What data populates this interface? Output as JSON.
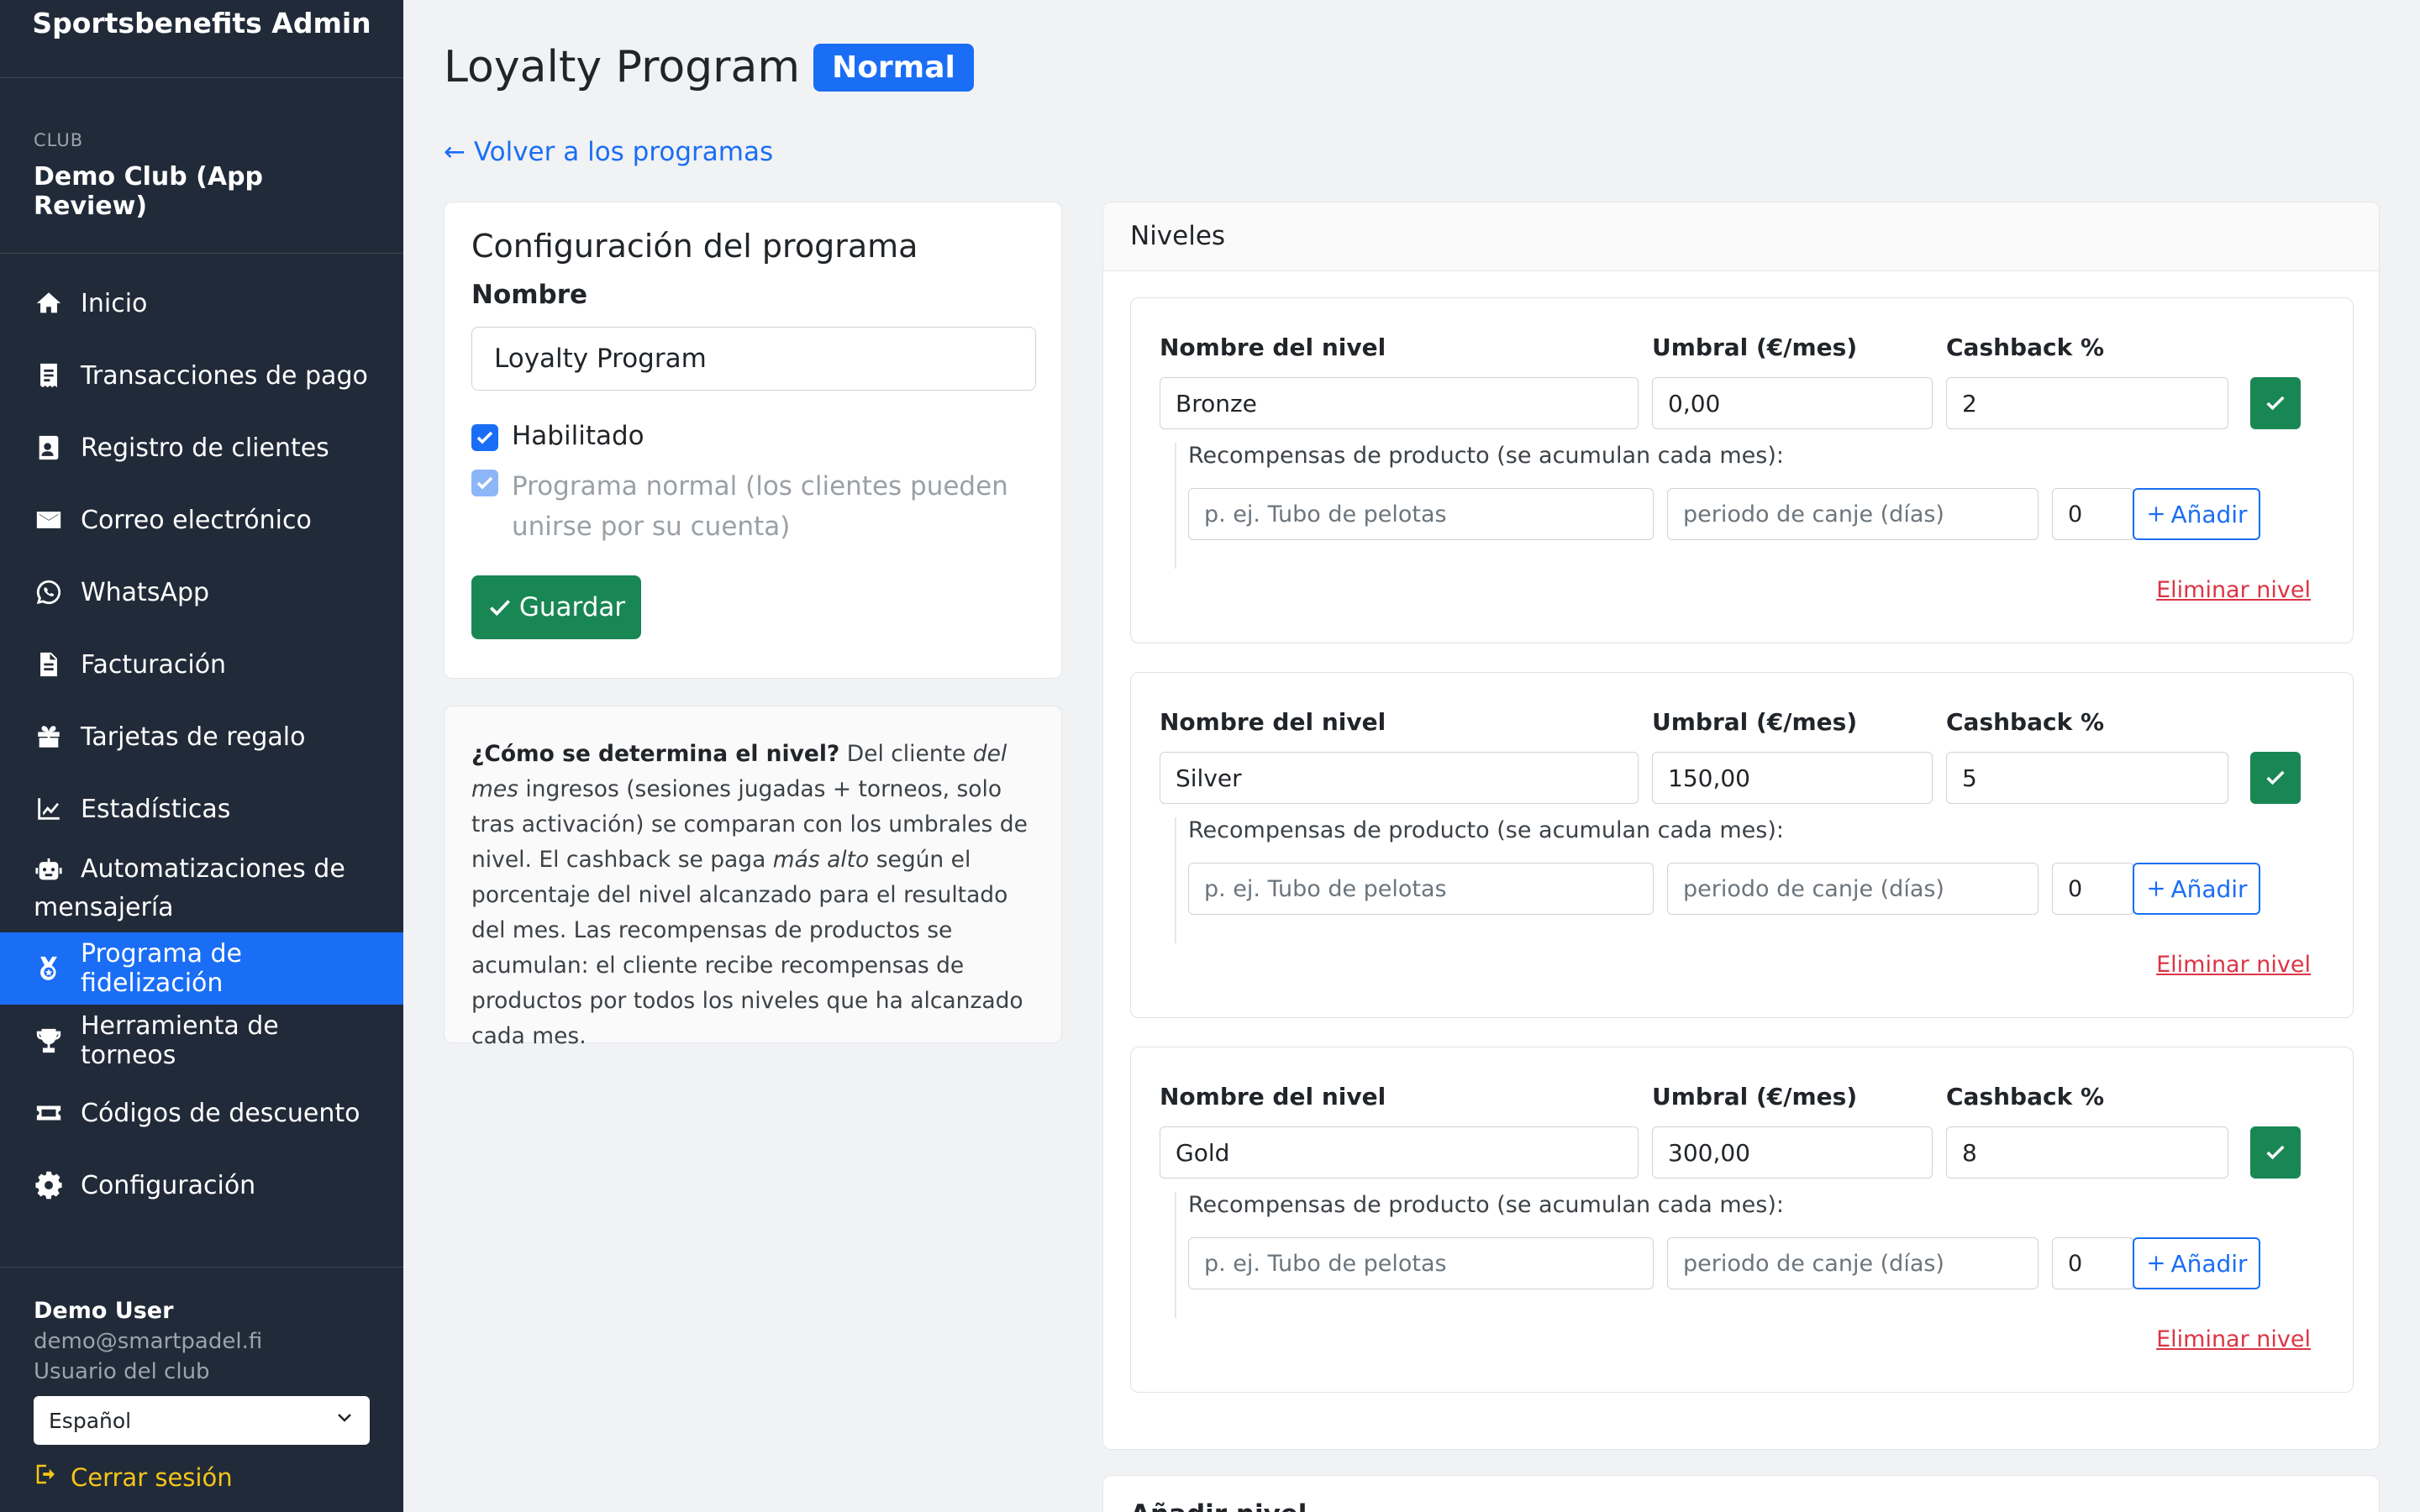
{
  "brand": "Sportsbenefits Admin",
  "club": {
    "caption": "CLUB",
    "name": "Demo Club (App Review)"
  },
  "nav": [
    {
      "label": "Inicio",
      "icon": "home-icon"
    },
    {
      "label": "Transacciones de pago",
      "icon": "receipt-icon"
    },
    {
      "label": "Registro de clientes",
      "icon": "contact-card-icon"
    },
    {
      "label": "Correo electrónico",
      "icon": "envelope-icon"
    },
    {
      "label": "WhatsApp",
      "icon": "whatsapp-icon"
    },
    {
      "label": "Facturación",
      "icon": "document-icon"
    },
    {
      "label": "Tarjetas de regalo",
      "icon": "gift-icon"
    },
    {
      "label": "Estadísticas",
      "icon": "chart-line-icon"
    },
    {
      "label": "Automatizaciones de mensajería",
      "icon": "robot-icon"
    },
    {
      "label": "Programa de fidelización",
      "icon": "medal-icon",
      "active": true
    },
    {
      "label": "Herramienta de torneos",
      "icon": "trophy-icon"
    },
    {
      "label": "Códigos de descuento",
      "icon": "ticket-icon"
    },
    {
      "label": "Configuración",
      "icon": "gear-icon"
    }
  ],
  "user": {
    "name": "Demo User",
    "email": "demo@smartpadel.fi",
    "role": "Usuario del club",
    "language": "Español",
    "logout": "Cerrar sesión"
  },
  "page": {
    "title": "Loyalty Program",
    "badge": "Normal",
    "back_link": "← Volver a los programas"
  },
  "config": {
    "title": "Configuración del programa",
    "name_label": "Nombre",
    "name_value": "Loyalty Program",
    "enabled_label": "Habilitado",
    "enabled_checked": true,
    "normal_label": "Programa normal (los clientes pueden unirse por su cuenta)",
    "normal_checked": true,
    "save_label": "Guardar"
  },
  "info": {
    "question": "¿Cómo se determina el nivel?",
    "t1": " Del cliente ",
    "em1": "del mes",
    "t2": " ingresos (sesiones jugadas + torneos, solo tras activación) se comparan con los umbrales de nivel. El cashback se paga ",
    "em2": "más alto",
    "t3": " según el porcentaje del nivel alcanzado para el resultado del mes. Las recompensas de productos se acumulan: el cliente recibe recompensas de productos por todos los niveles que ha alcanzado cada mes."
  },
  "levels": {
    "header": "Niveles",
    "name_label": "Nombre del nivel",
    "threshold_label": "Umbral (€/mes)",
    "cashback_label": "Cashback %",
    "rewards_label": "Recompensas de producto (se acumulan cada mes):",
    "product_placeholder": "p. ej. Tubo de pelotas",
    "period_placeholder": "periodo de canje (días)",
    "add_label": "Añadir",
    "delete_label": "Eliminar nivel",
    "items": [
      {
        "name": "Bronze",
        "threshold": "0,00",
        "cashback": "2",
        "qty": "0"
      },
      {
        "name": "Silver",
        "threshold": "150,00",
        "cashback": "5",
        "qty": "0"
      },
      {
        "name": "Gold",
        "threshold": "300,00",
        "cashback": "8",
        "qty": "0"
      }
    ]
  },
  "add_level": {
    "title": "Añadir nivel"
  }
}
